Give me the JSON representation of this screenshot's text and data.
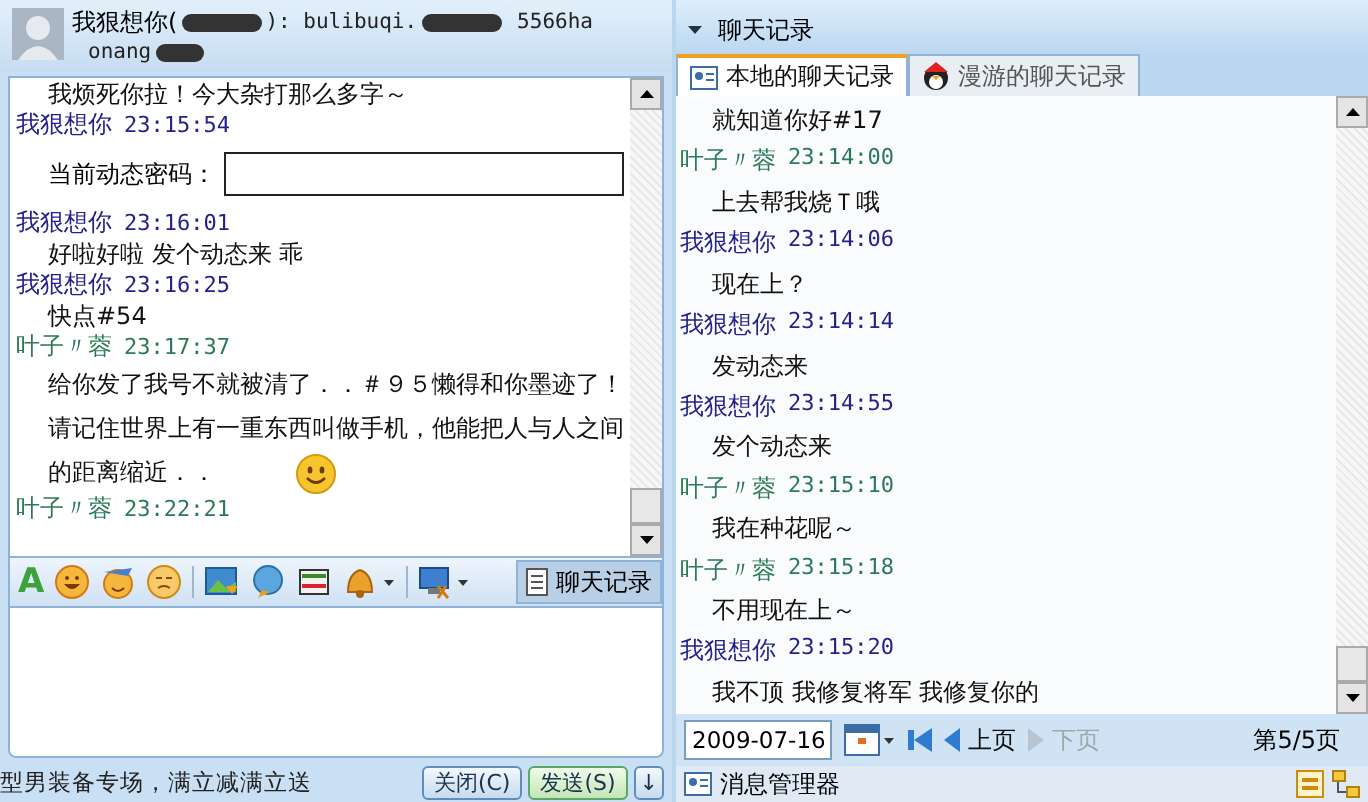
{
  "chat": {
    "header": {
      "name": "我狠想你(",
      "account": "): bulibuqi.",
      "signature": "5566ha",
      "signature_2": "onang"
    },
    "messages": [
      {
        "kind": "body",
        "text": "我烦死你拉！今大杂打那么多字～"
      },
      {
        "kind": "header",
        "sender": "我狠想你",
        "time": "23:15:54",
        "color": "#22228a"
      },
      {
        "kind": "field",
        "label": "当前动态密码："
      },
      {
        "kind": "header",
        "sender": "我狠想你",
        "time": "23:16:01",
        "color": "#22228a"
      },
      {
        "kind": "body",
        "text": "好啦好啦 发个动态来 乖"
      },
      {
        "kind": "header",
        "sender": "我狠想你",
        "time": "23:16:25",
        "color": "#22228a"
      },
      {
        "kind": "body",
        "text": "快点#54"
      },
      {
        "kind": "header",
        "sender": "叶子〃蓉",
        "time": "23:17:37",
        "color": "#2a7a55"
      },
      {
        "kind": "body",
        "text": "给你发了我号不就被清了．．＃９５懒得和你墨迹了！请记住世界上有一重东西叫做手机，他能把人与人之间的距离缩近．．",
        "emoji": true
      },
      {
        "kind": "header",
        "sender": "叶子〃蓉",
        "time": "23:22:21",
        "color": "#2a7a55"
      }
    ],
    "toolbar": {
      "font_button": "A",
      "history_button": {
        "label": "聊天记录",
        "pressed": true
      }
    },
    "ad_text": "型男装备专场，满立减满立送",
    "buttons": {
      "close": "关闭(C)",
      "send": "发送(S)",
      "send_menu": "↓"
    }
  },
  "history": {
    "title": "聊天记录",
    "tabs": [
      {
        "label": "本地的聊天记录",
        "selected": true
      },
      {
        "label": "漫游的聊天记录",
        "selected": false
      }
    ],
    "messages": [
      {
        "kind": "body",
        "text": "就知道你好#17"
      },
      {
        "kind": "header",
        "sender": "叶子〃蓉",
        "time": "23:14:00",
        "color": "#2a7a55"
      },
      {
        "kind": "body",
        "text": "上去帮我烧Ｔ哦"
      },
      {
        "kind": "header",
        "sender": "我狠想你",
        "time": "23:14:06",
        "color": "#22228a"
      },
      {
        "kind": "body",
        "text": "现在上？"
      },
      {
        "kind": "header",
        "sender": "我狠想你",
        "time": "23:14:14",
        "color": "#22228a"
      },
      {
        "kind": "body",
        "text": "发动态来"
      },
      {
        "kind": "header",
        "sender": "我狠想你",
        "time": "23:14:55",
        "color": "#22228a"
      },
      {
        "kind": "body",
        "text": "发个动态来"
      },
      {
        "kind": "header",
        "sender": "叶子〃蓉",
        "time": "23:15:10",
        "color": "#2a7a55"
      },
      {
        "kind": "body",
        "text": "我在种花呢～"
      },
      {
        "kind": "header",
        "sender": "叶子〃蓉",
        "time": "23:15:18",
        "color": "#2a7a55"
      },
      {
        "kind": "body",
        "text": "不用现在上～"
      },
      {
        "kind": "header",
        "sender": "我狠想你",
        "time": "23:15:20",
        "color": "#22228a"
      },
      {
        "kind": "body",
        "text": "我不顶 我修复将军 我修复你的"
      }
    ],
    "pager": {
      "date": "2009-07-16",
      "prev": {
        "label": "上页",
        "disabled": false
      },
      "next": {
        "label": "下页",
        "disabled": true
      },
      "page": "第5/5页"
    },
    "footer": {
      "manager": "消息管理器"
    }
  }
}
